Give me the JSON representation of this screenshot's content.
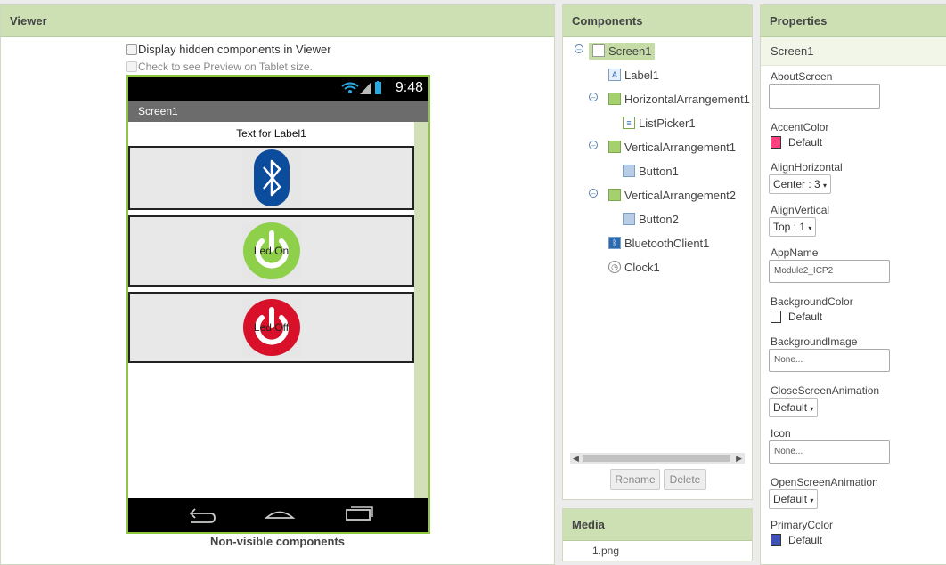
{
  "viewer": {
    "title": "Viewer",
    "hidden_label": "Display hidden components in Viewer",
    "tablet_label": "Check to see Preview on Tablet size.",
    "phone": {
      "time": "9:48",
      "screen_title": "Screen1",
      "label_text": "Text for Label1",
      "button1_text": "Led On",
      "button2_text": "Led Off"
    },
    "nonvisible_label": "Non-visible components"
  },
  "components": {
    "title": "Components",
    "tree": [
      {
        "label": "Screen1",
        "icon": "screen-icon"
      },
      {
        "label": "Label1",
        "icon": "label-icon"
      },
      {
        "label": "HorizontalArrangement1",
        "icon": "horizontal-arrangement-icon"
      },
      {
        "label": "ListPicker1",
        "icon": "listpicker-icon"
      },
      {
        "label": "VerticalArrangement1",
        "icon": "vertical-arrangement-icon"
      },
      {
        "label": "Button1",
        "icon": "button-icon"
      },
      {
        "label": "VerticalArrangement2",
        "icon": "vertical-arrangement-icon"
      },
      {
        "label": "Button2",
        "icon": "button-icon"
      },
      {
        "label": "BluetoothClient1",
        "icon": "bluetooth-icon"
      },
      {
        "label": "Clock1",
        "icon": "clock-icon"
      }
    ],
    "rename_label": "Rename",
    "delete_label": "Delete"
  },
  "media": {
    "title": "Media",
    "file": "1.png"
  },
  "properties": {
    "title": "Properties",
    "component": "Screen1",
    "about_screen": "AboutScreen",
    "accent_color": {
      "label": "AccentColor",
      "value": "Default",
      "color": "#ff4081"
    },
    "align_horizontal": {
      "label": "AlignHorizontal",
      "value": "Center : 3"
    },
    "align_vertical": {
      "label": "AlignVertical",
      "value": "Top : 1"
    },
    "app_name": {
      "label": "AppName",
      "value": "Module2_ICP2"
    },
    "background_color": {
      "label": "BackgroundColor",
      "value": "Default",
      "color": "#ffffff"
    },
    "background_image": {
      "label": "BackgroundImage",
      "value": "None..."
    },
    "close_animation": {
      "label": "CloseScreenAnimation",
      "value": "Default"
    },
    "icon": {
      "label": "Icon",
      "value": "None..."
    },
    "open_animation": {
      "label": "OpenScreenAnimation",
      "value": "Default"
    },
    "primary_color": {
      "label": "PrimaryColor",
      "value": "Default",
      "color": "#3f51b5"
    }
  }
}
